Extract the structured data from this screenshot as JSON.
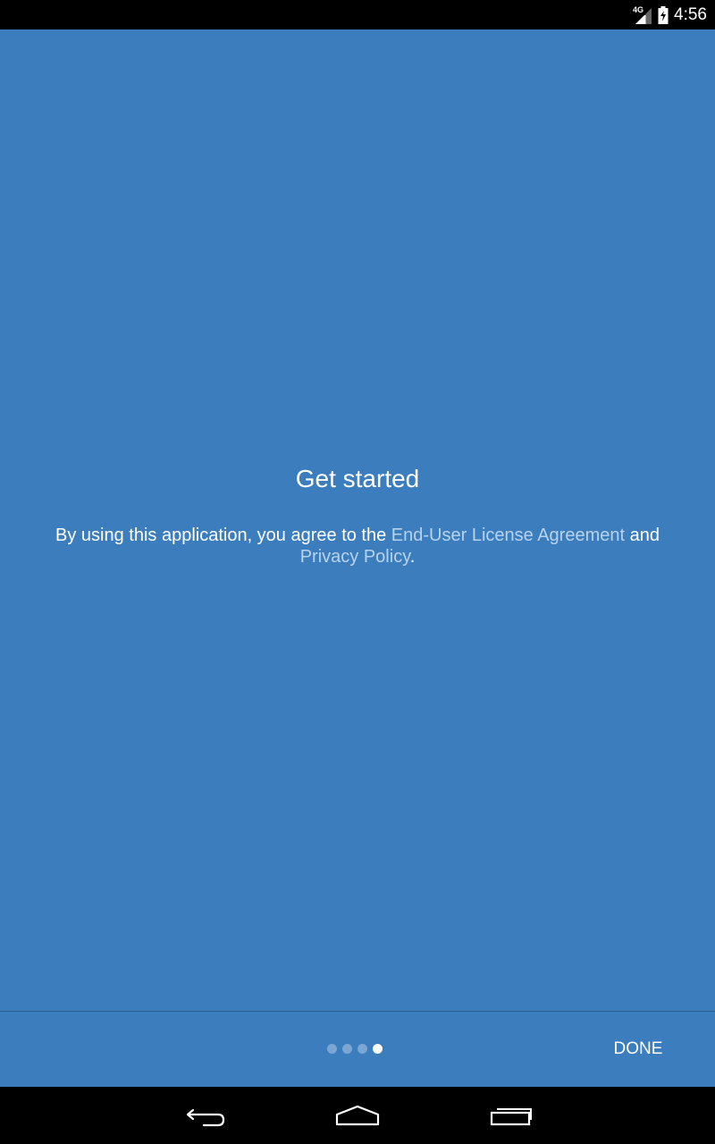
{
  "status_bar": {
    "network_label": "4G",
    "time": "4:56",
    "icons": [
      "signal-icon",
      "battery-charging-icon"
    ]
  },
  "main": {
    "title": "Get started",
    "legal": {
      "prefix": "By using this application, you agree to the ",
      "eula_link": "End-User License Agreement",
      "middle": " and ",
      "privacy_link": "Privacy Policy",
      "suffix": "."
    }
  },
  "pager": {
    "page_count": 4,
    "current_page": 4
  },
  "bottom_bar": {
    "done_label": "DONE"
  },
  "nav_bar": {
    "icons": [
      "back-icon",
      "home-icon",
      "recents-icon"
    ]
  },
  "colors": {
    "background": "#3b7dbd",
    "link": "#b8d3ee",
    "text": "#ffffff",
    "system_bars": "#000000"
  }
}
